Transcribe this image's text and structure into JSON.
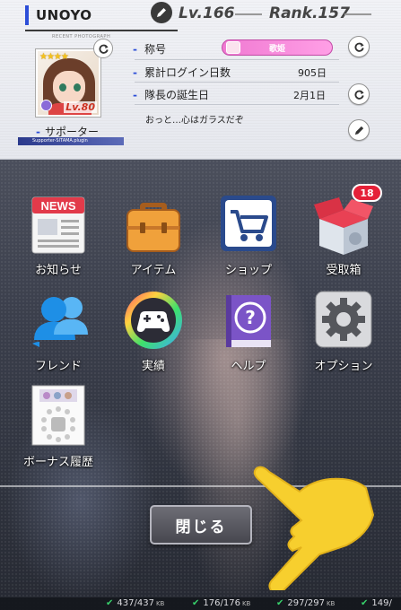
{
  "profile": {
    "name": "UNOYO",
    "level_label": "Lv.166",
    "rank_label": "Rank.157",
    "photo_caption": "RECENT PHOTOGRAPH",
    "avatar_level": "Lv.80",
    "avatar_stars": "★★★★",
    "supporter_label": "サポーター",
    "plugin_label": "Supporter-SITAMA.plugin",
    "title_label": "称号",
    "title_value": "歌姫",
    "login_days_label": "累計ログイン日数",
    "login_days_value": "905日",
    "birthday_label": "隊長の誕生日",
    "birthday_value": "2月1日",
    "comment": "おっと…心はガラスだぞ"
  },
  "menu": {
    "items": [
      {
        "label": "お知らせ",
        "icon": "news-icon"
      },
      {
        "label": "アイテム",
        "icon": "briefcase-icon"
      },
      {
        "label": "ショップ",
        "icon": "cart-icon"
      },
      {
        "label": "受取箱",
        "icon": "gift-box-icon"
      },
      {
        "label": "フレンド",
        "icon": "friends-icon"
      },
      {
        "label": "実績",
        "icon": "gamepad-icon"
      },
      {
        "label": "ヘルプ",
        "icon": "help-book-icon"
      },
      {
        "label": "オプション",
        "icon": "gear-icon"
      },
      {
        "label": "ボーナス履歴",
        "icon": "bonus-calendar-icon"
      }
    ],
    "news_word": "NEWS",
    "gift_badge": "18"
  },
  "close_label": "閉じる",
  "status_bar": {
    "downloads": [
      {
        "value": "437/437",
        "unit": "KB"
      },
      {
        "value": "176/176",
        "unit": "KB"
      },
      {
        "value": "297/297",
        "unit": "KB"
      },
      {
        "value": "149/",
        "unit": ""
      }
    ]
  },
  "colors": {
    "accent_blue": "#2c4ed8",
    "title_pink": "#f07ad2",
    "badge_red": "#e52038",
    "hand_yellow": "#f7cf2e"
  }
}
